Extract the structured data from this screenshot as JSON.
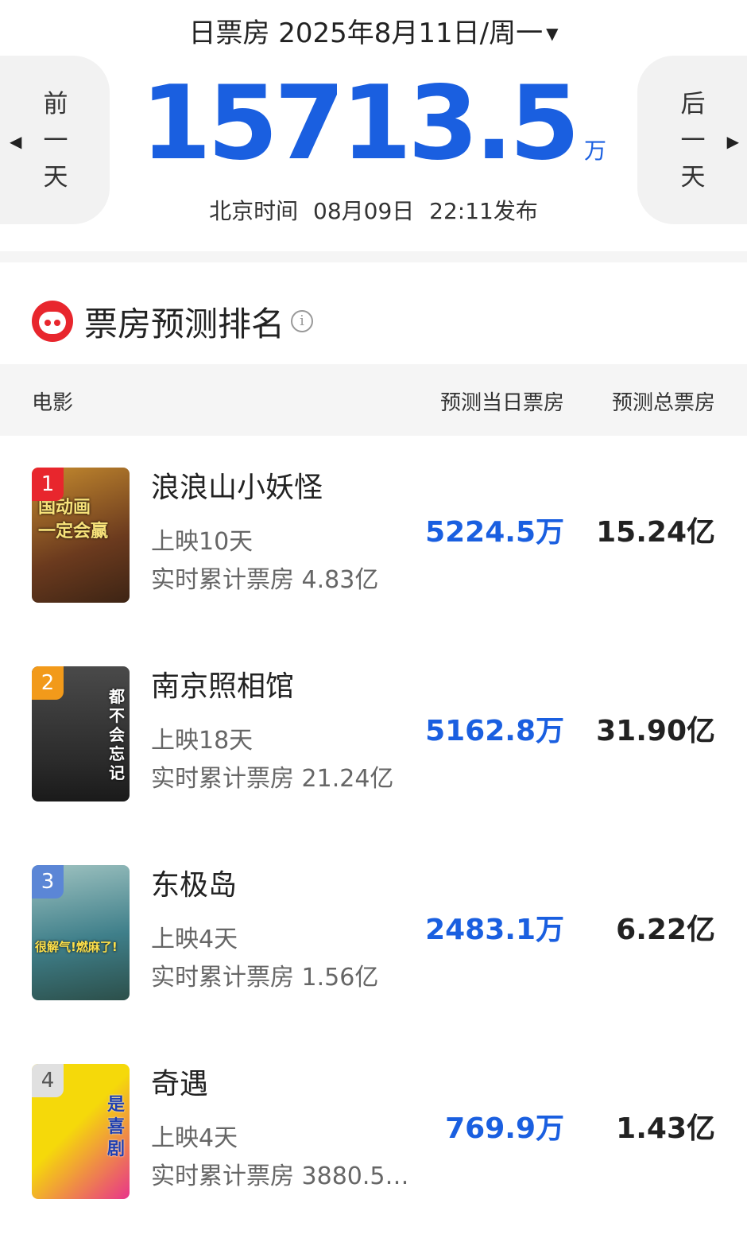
{
  "header": {
    "date_title": "日票房 2025年8月11日/周一",
    "prev_label": "前\n一\n天",
    "next_label": "后\n一\n天",
    "total_amount": "15713.5",
    "total_unit": "万",
    "publish_time": "北京时间 08月09日 22:11发布"
  },
  "section": {
    "title": "票房预测排名",
    "info_symbol": "i"
  },
  "table": {
    "col_movie": "电影",
    "col_day": "预测当日票房",
    "col_total": "预测总票房"
  },
  "movies": [
    {
      "rank": "1",
      "badge_color": "#e8262d",
      "poster_colors": [
        "#6b3a1e",
        "#c48a2e"
      ],
      "poster_text": "国动画\n一定会赢",
      "title": "浪浪山小妖怪",
      "days": "上映10天",
      "cumulative": "实时累计票房 4.83亿",
      "day_forecast": "5224.5万",
      "total_forecast": "15.24亿"
    },
    {
      "rank": "2",
      "badge_color": "#f29a1a",
      "poster_colors": [
        "#2b2b2b",
        "#4a4a4a"
      ],
      "poster_text": "都\n不\n会\n忘\n记",
      "title": "南京照相馆",
      "days": "上映18天",
      "cumulative": "实时累计票房 21.24亿",
      "day_forecast": "5162.8万",
      "total_forecast": "31.90亿"
    },
    {
      "rank": "3",
      "badge_color": "#5b86d6",
      "poster_colors": [
        "#3f7f8a",
        "#9ec2c0"
      ],
      "poster_text": "很解气!燃麻了!",
      "title": "东极岛",
      "days": "上映4天",
      "cumulative": "实时累计票房 1.56亿",
      "day_forecast": "2483.1万",
      "total_forecast": "6.22亿"
    },
    {
      "rank": "4",
      "badge_color": "#b5b5b5",
      "poster_colors": [
        "#f5d90a",
        "#e8348a"
      ],
      "poster_text": "是\n喜\n剧",
      "title": "奇遇",
      "days": "上映4天",
      "cumulative": "实时累计票房 3880.5…",
      "day_forecast": "769.9万",
      "total_forecast": "1.43亿"
    }
  ]
}
